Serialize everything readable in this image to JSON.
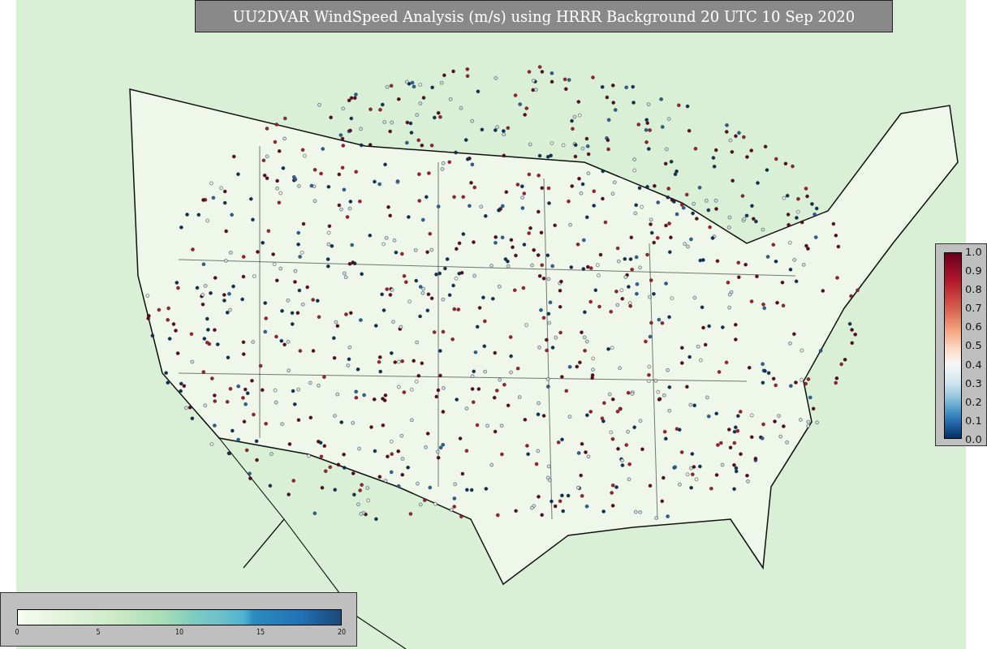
{
  "title": "UU2DVAR WindSpeed Analysis (m/s) using HRRR Background 20 UTC 10 Sep 2020",
  "wind_colorbar": {
    "ticks": [
      "0",
      "5",
      "10",
      "15",
      "20"
    ]
  },
  "ratio_colorbar": {
    "ticks": [
      "1.0",
      "0.9",
      "0.8",
      "0.7",
      "0.6",
      "0.5",
      "0.4",
      "0.3",
      "0.2",
      "0.1",
      "0.0"
    ]
  }
}
